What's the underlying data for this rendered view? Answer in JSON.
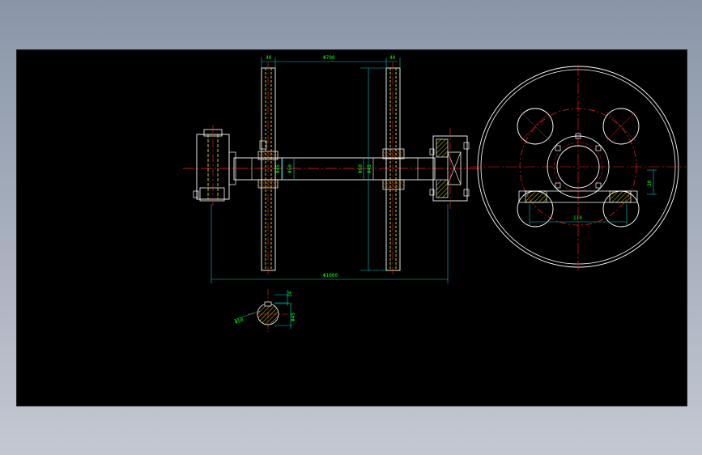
{
  "drawing": {
    "colors": {
      "background": "#000000",
      "outline": "#ffffff",
      "centerline": "#ff2020",
      "dimension": "#00c8c8",
      "dimension_text": "#00ff00",
      "hatch": "#ffff00",
      "detail": "#ff8c00"
    },
    "dimensions": {
      "top_left_flange": "40",
      "top_span": "Φ700",
      "top_right_flange": "40",
      "shaft_dia_1": "Φ45",
      "shaft_dia_2": "Φ50",
      "shaft_dia_3": "Φ60",
      "shaft_dia_4": "Φ45",
      "overall_length": "Φ1000",
      "section_top": "14",
      "section_side": "Φ45",
      "section_label": "Φ50",
      "circle_horizontal": "110",
      "circle_vertical": "30"
    }
  }
}
